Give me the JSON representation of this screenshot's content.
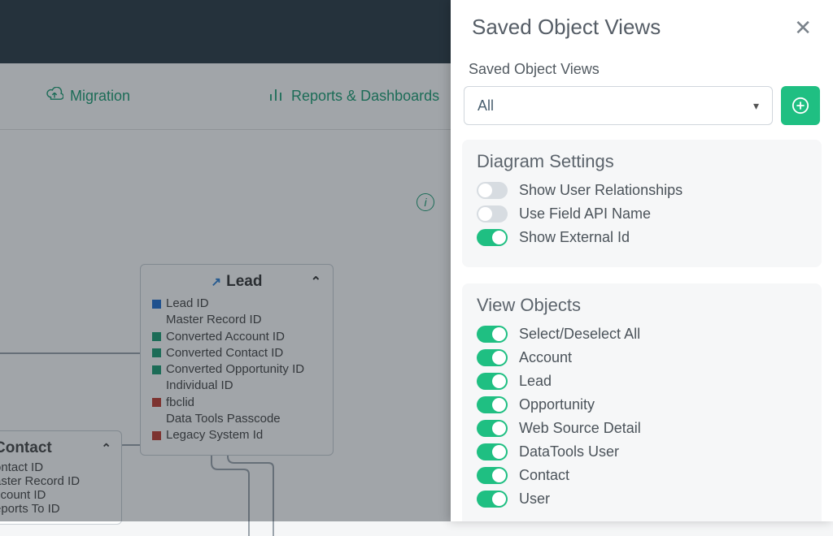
{
  "nav": {
    "migration": "Migration",
    "reports": "Reports & Dashboards"
  },
  "leadCard": {
    "title": "Lead",
    "rows": [
      {
        "color": "blue",
        "label": "Lead ID"
      },
      {
        "color": "none",
        "label": "Master Record ID"
      },
      {
        "color": "green",
        "label": "Converted Account ID"
      },
      {
        "color": "green",
        "label": "Converted Contact ID"
      },
      {
        "color": "green",
        "label": "Converted Opportunity ID"
      },
      {
        "color": "none",
        "label": "Individual ID"
      },
      {
        "color": "red",
        "label": "fbclid"
      },
      {
        "color": "none",
        "label": "Data Tools Passcode"
      },
      {
        "color": "red",
        "label": "Legacy System Id"
      }
    ]
  },
  "contactCard": {
    "title": "Contact",
    "rows": [
      "ontact ID",
      "aster Record ID",
      "ccount ID",
      "eports To ID"
    ]
  },
  "panel": {
    "title": "Saved Object Views",
    "selectLabel": "Saved Object Views",
    "selectValue": "All",
    "diagram": {
      "title": "Diagram Settings",
      "items": [
        {
          "label": "Show User Relationships",
          "on": false
        },
        {
          "label": "Use Field API Name",
          "on": false
        },
        {
          "label": "Show External Id",
          "on": true
        }
      ]
    },
    "viewObjects": {
      "title": "View Objects",
      "items": [
        {
          "label": "Select/Deselect All",
          "on": true
        },
        {
          "label": "Account",
          "on": true
        },
        {
          "label": "Lead",
          "on": true
        },
        {
          "label": "Opportunity",
          "on": true
        },
        {
          "label": "Web Source Detail",
          "on": true
        },
        {
          "label": "DataTools User",
          "on": true
        },
        {
          "label": "Contact",
          "on": true
        },
        {
          "label": "User",
          "on": true
        }
      ]
    }
  }
}
